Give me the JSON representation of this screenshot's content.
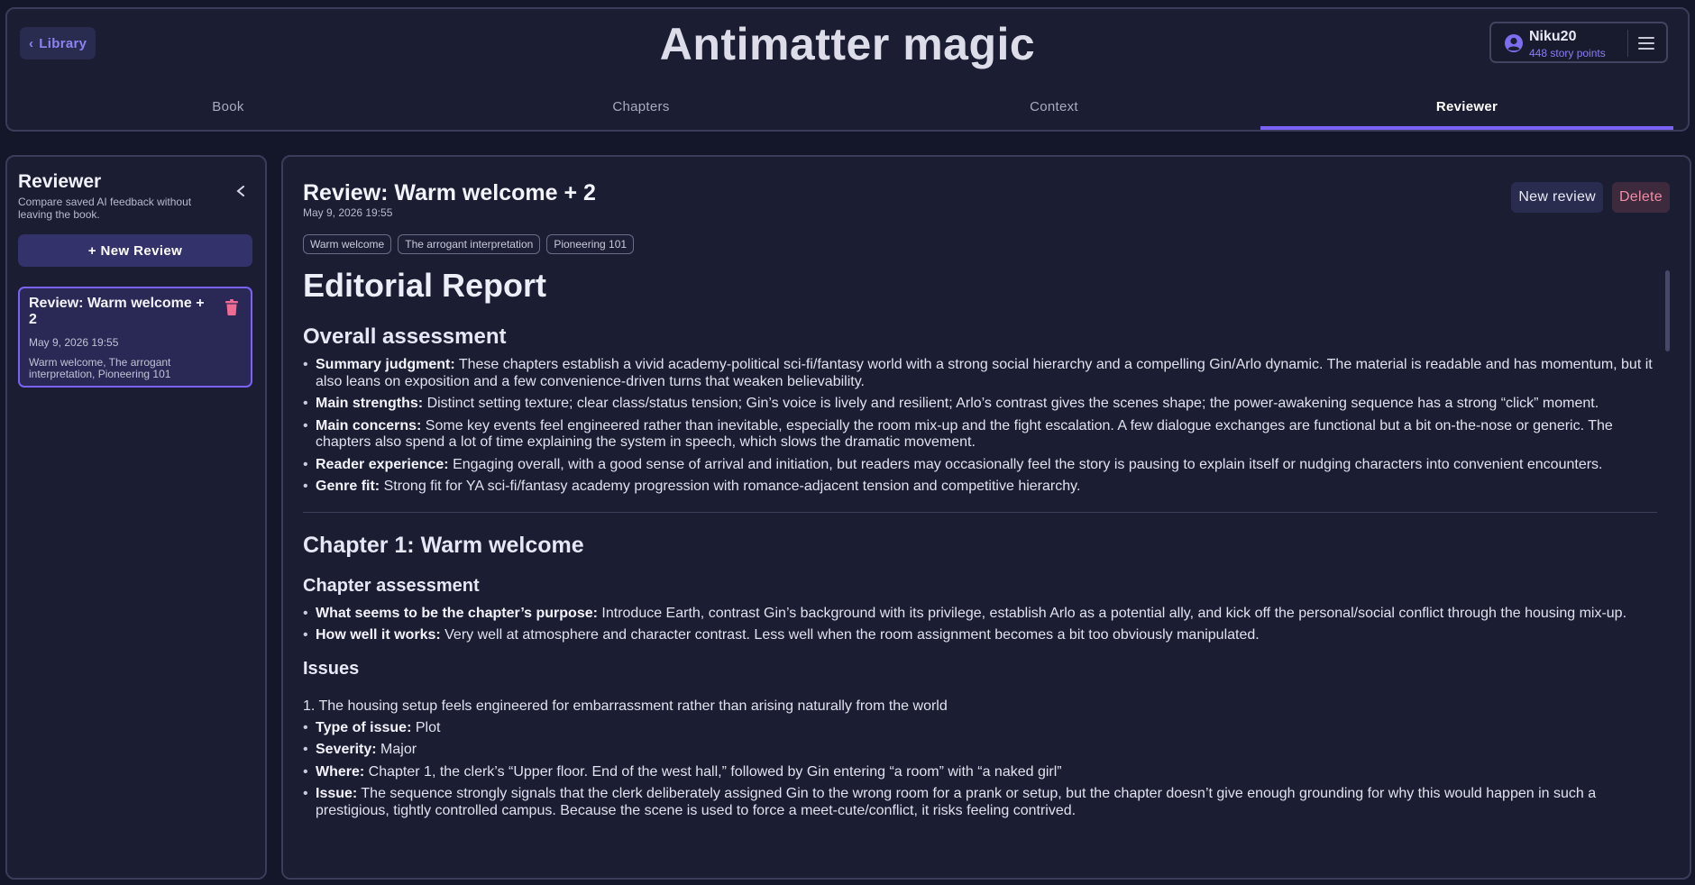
{
  "header": {
    "back_label": "Library",
    "app_title": "Antimatter magic",
    "user": {
      "name": "Niku20",
      "points": "448 story points"
    },
    "tabs": [
      {
        "label": "Book",
        "active": false
      },
      {
        "label": "Chapters",
        "active": false
      },
      {
        "label": "Context",
        "active": false
      },
      {
        "label": "Reviewer",
        "active": true
      }
    ]
  },
  "sidebar": {
    "title": "Reviewer",
    "subtitle": "Compare saved AI feedback without leaving the book.",
    "new_review_label": "+ New Review",
    "reviews": [
      {
        "title": "Review: Warm welcome + 2",
        "date": "May 9, 2026 19:55",
        "chapters": "Warm welcome, The arrogant interpretation, Pioneering 101",
        "selected": true
      }
    ]
  },
  "review": {
    "title": "Review: Warm welcome + 2",
    "date": "May 9, 2026 19:55",
    "new_review_label": "New review",
    "delete_label": "Delete",
    "tags": [
      "Warm welcome",
      "The arrogant interpretation",
      "Pioneering 101"
    ],
    "report_title": "Editorial Report",
    "overall": {
      "heading": "Overall assessment",
      "items": [
        {
          "label": "Summary judgment:",
          "text": " These chapters establish a vivid academy-political sci-fi/fantasy world with a strong social hierarchy and a compelling Gin/Arlo dynamic. The material is readable and has momentum, but it also leans on exposition and a few convenience-driven turns that weaken believability."
        },
        {
          "label": "Main strengths:",
          "text": " Distinct setting texture; clear class/status tension; Gin’s voice is lively and resilient; Arlo’s contrast gives the scenes shape; the power-awakening sequence has a strong “click” moment."
        },
        {
          "label": "Main concerns:",
          "text": " Some key events feel engineered rather than inevitable, especially the room mix-up and the fight escalation. A few dialogue exchanges are functional but a bit on-the-nose or generic. The chapters also spend a lot of time explaining the system in speech, which slows the dramatic movement."
        },
        {
          "label": "Reader experience:",
          "text": " Engaging overall, with a good sense of arrival and initiation, but readers may occasionally feel the story is pausing to explain itself or nudging characters into convenient encounters."
        },
        {
          "label": "Genre fit:",
          "text": " Strong fit for YA sci-fi/fantasy academy progression with romance-adjacent tension and competitive hierarchy."
        }
      ]
    },
    "chapter1": {
      "heading": "Chapter 1: Warm welcome",
      "assessment_heading": "Chapter assessment",
      "assessment_items": [
        {
          "label": "What seems to be the chapter’s purpose:",
          "text": " Introduce Earth, contrast Gin’s background with its privilege, establish Arlo as a potential ally, and kick off the personal/social conflict through the housing mix-up."
        },
        {
          "label": "How well it works:",
          "text": " Very well at atmosphere and character contrast. Less well when the room assignment becomes a bit too obviously manipulated."
        }
      ],
      "issues_heading": "Issues",
      "issue_title": "1. The housing setup feels engineered for embarrassment rather than arising naturally from the world",
      "issue_items": [
        {
          "label": "Type of issue:",
          "text": " Plot"
        },
        {
          "label": "Severity:",
          "text": " Major"
        },
        {
          "label": "Where:",
          "text": " Chapter 1, the clerk’s “Upper floor. End of the west hall,” followed by Gin entering “a room” with “a naked girl”"
        },
        {
          "label": "Issue:",
          "text": " The sequence strongly signals that the clerk deliberately assigned Gin to the wrong room for a prank or setup, but the chapter doesn’t give enough grounding for why this would happen in such a prestigious, tightly controlled campus. Because the scene is used to force a meet-cute/conflict, it risks feeling contrived."
        }
      ]
    }
  },
  "colors": {
    "background": "#141629",
    "panel": "#1b1d33",
    "accent": "#7a62f5",
    "delete": "#ef8da6"
  }
}
